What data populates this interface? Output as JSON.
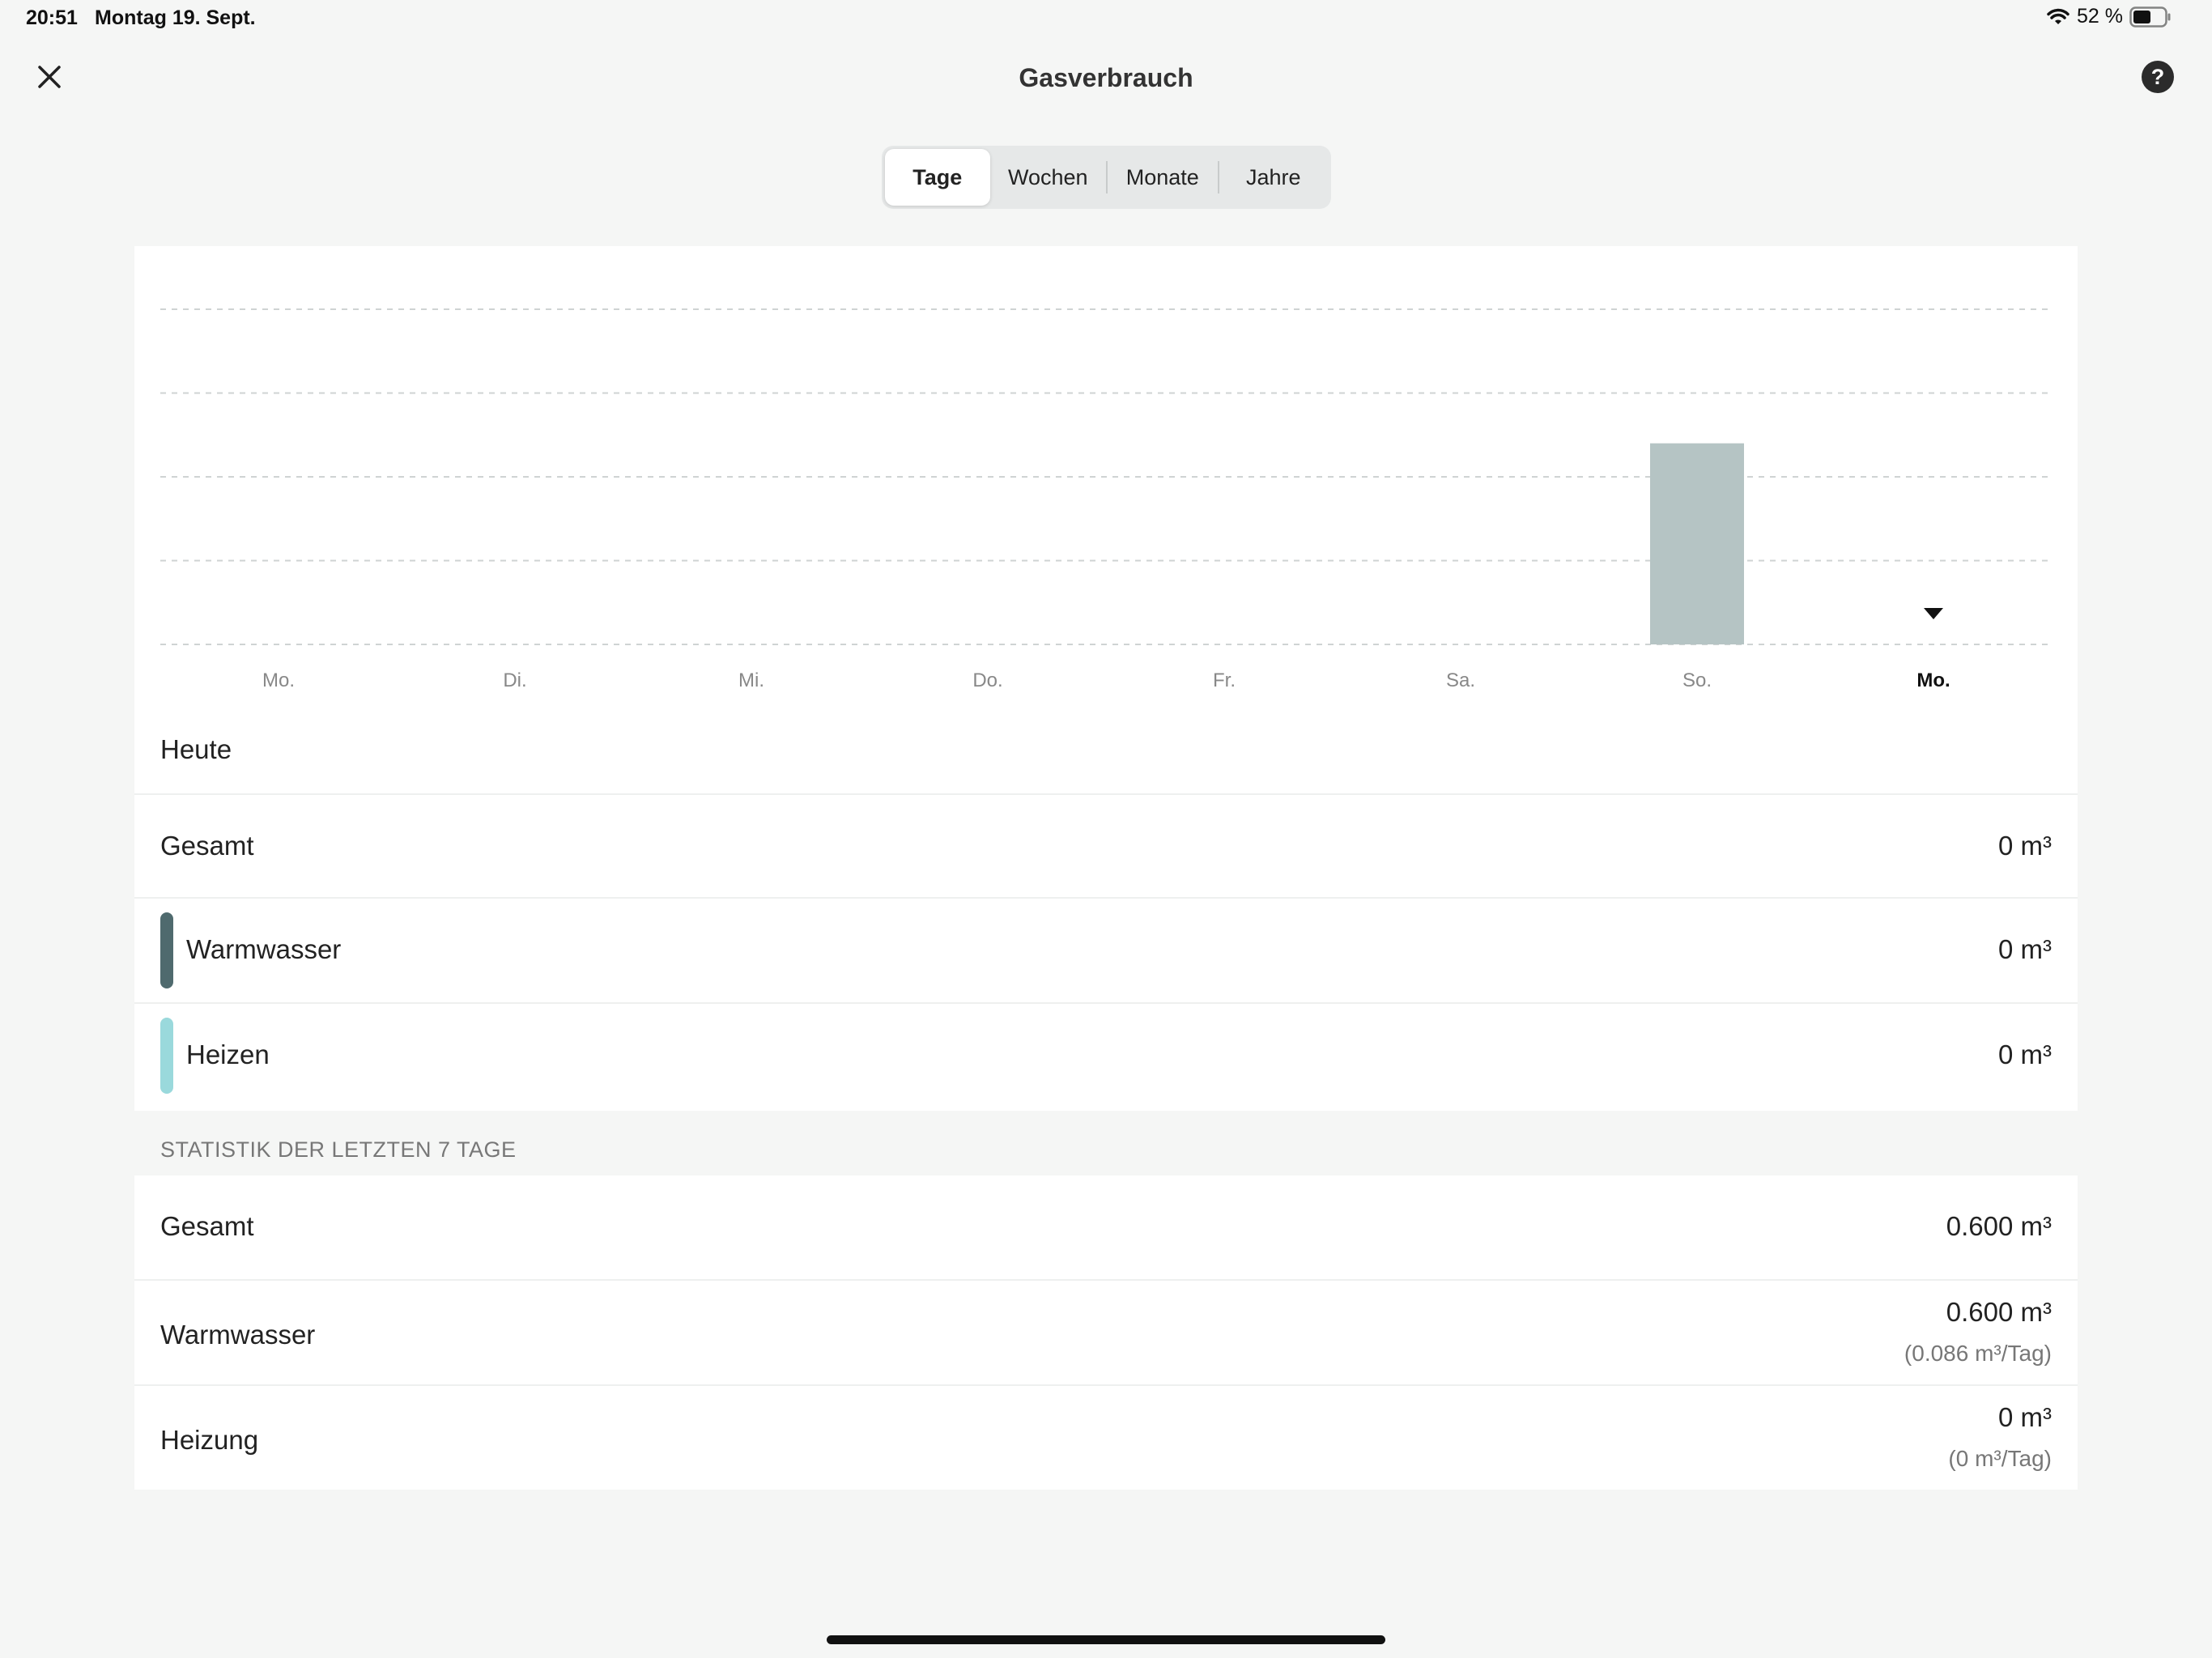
{
  "status_bar": {
    "time": "20:51",
    "date": "Montag 19. Sept.",
    "battery": "52 %"
  },
  "header": {
    "title": "Gasverbrauch"
  },
  "tabs": [
    {
      "label": "Tage",
      "active": true
    },
    {
      "label": "Wochen",
      "active": false
    },
    {
      "label": "Monate",
      "active": false
    },
    {
      "label": "Jahre",
      "active": false
    }
  ],
  "chart_data": {
    "type": "bar",
    "categories": [
      "Mo.",
      "Di.",
      "Mi.",
      "Do.",
      "Fr.",
      "Sa.",
      "So.",
      "Mo."
    ],
    "selected_index": 7,
    "series": [
      {
        "values": [
          0,
          0,
          0,
          0,
          0,
          0,
          0.6,
          0
        ],
        "color": "#b5c4c4"
      }
    ],
    "ylim": [
      0,
      1.0
    ],
    "grid": true,
    "gridlines": 5
  },
  "today": {
    "label": "Heute",
    "rows": [
      {
        "label": "Gesamt",
        "value": "0 m³"
      },
      {
        "label": "Warmwasser",
        "value": "0 m³",
        "color": "#4f6a6e"
      },
      {
        "label": "Heizen",
        "value": "0 m³",
        "color": "#9ad9dc"
      }
    ]
  },
  "stats": {
    "header": "STATISTIK DER LETZTEN 7 TAGE",
    "rows": [
      {
        "label": "Gesamt",
        "value": "0.600 m³"
      },
      {
        "label": "Warmwasser",
        "value": "0.600 m³",
        "sub": "(0.086 m³/Tag)"
      },
      {
        "label": "Heizung",
        "value": "0 m³",
        "sub": "(0 m³/Tag)"
      }
    ]
  }
}
